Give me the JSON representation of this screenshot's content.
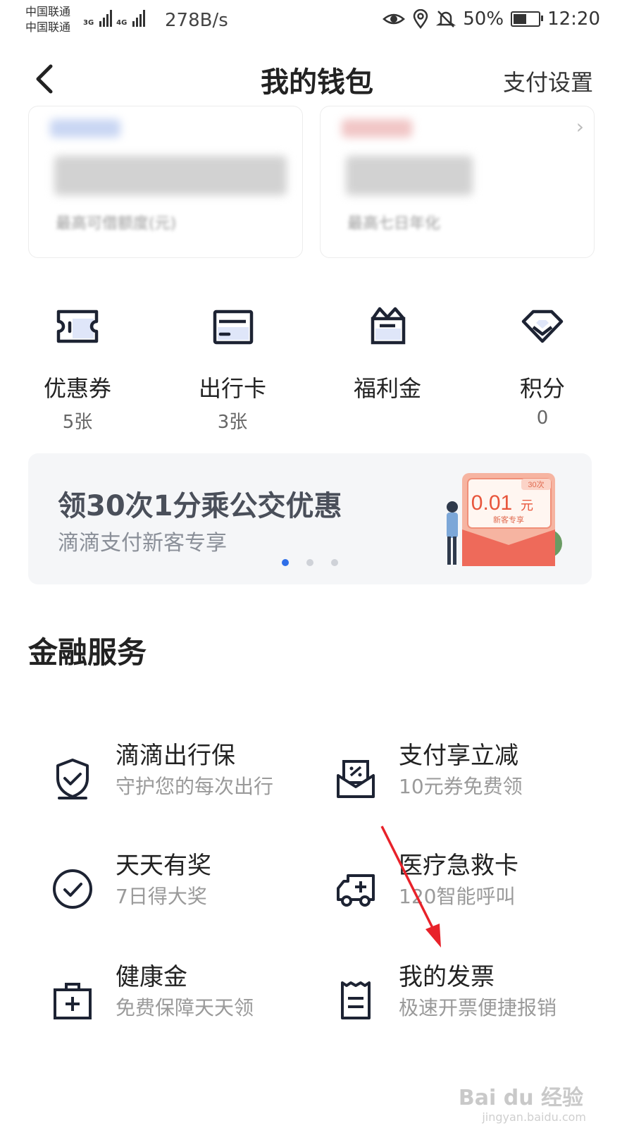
{
  "status_bar": {
    "carrier_1": "中国联通",
    "carrier_2": "中国联通",
    "net_1": "3G",
    "net_2": "4G",
    "speed": "278B/s",
    "battery": "50%",
    "time": "12:20"
  },
  "header": {
    "title": "我的钱包",
    "settings_label": "支付设置"
  },
  "cards": [
    {
      "caption": "最高可借额度(元)"
    },
    {
      "caption": "最高七日年化"
    }
  ],
  "quick_entries": [
    {
      "label": "优惠券",
      "sub": "5张",
      "icon": "coupon-icon"
    },
    {
      "label": "出行卡",
      "sub": "3张",
      "icon": "travel-card-icon"
    },
    {
      "label": "福利金",
      "sub": "",
      "icon": "gift-box-icon"
    },
    {
      "label": "积分",
      "sub": "0",
      "icon": "points-diamond-icon"
    }
  ],
  "banner": {
    "headline": "领30次1分乘公交优惠",
    "subline": "滴滴支付新客专享",
    "coupon_amount": "0.01",
    "coupon_unit": "元",
    "coupon_tag": "30次",
    "coupon_note": "新客专享",
    "active_dot": 0,
    "dot_count": 3
  },
  "section_title": "金融服务",
  "services": [
    {
      "title": "滴滴出行保",
      "desc": "守护您的每次出行",
      "icon": "shield-check-icon"
    },
    {
      "title": "支付享立减",
      "desc": "10元券免费领",
      "icon": "envelope-discount-icon"
    },
    {
      "title": "天天有奖",
      "desc": "7日得大奖",
      "icon": "check-circle-icon"
    },
    {
      "title": "医疗急救卡",
      "desc": "120智能呼叫",
      "icon": "ambulance-icon"
    },
    {
      "title": "健康金",
      "desc": "免费保障天天领",
      "icon": "medical-kit-icon"
    },
    {
      "title": "我的发票",
      "desc": "极速开票便捷报销",
      "icon": "invoice-icon"
    }
  ],
  "watermark": {
    "brand": "Bai du 经验",
    "url": "jingyan.baidu.com"
  },
  "colors": {
    "accent": "#2f6fe8",
    "arrow": "#e8222a",
    "icon_stroke": "#1d2333"
  }
}
